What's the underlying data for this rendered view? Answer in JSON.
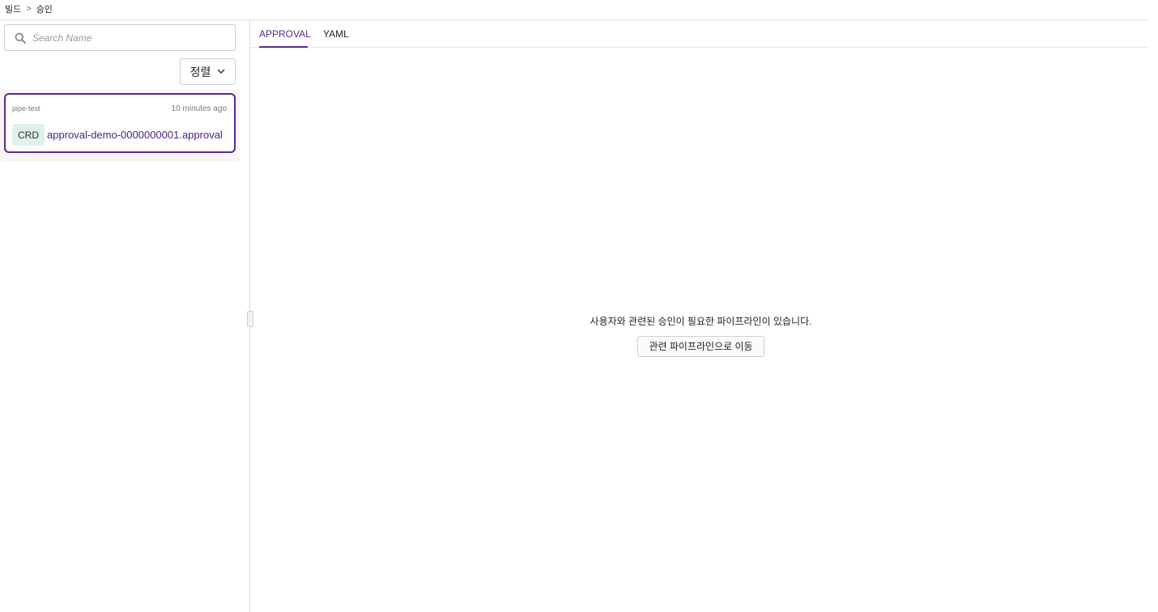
{
  "breadcrumb": {
    "items": [
      "빌드",
      "승인"
    ],
    "separator": ">"
  },
  "sidebar": {
    "search": {
      "placeholder": "Search Name",
      "value": "",
      "icon": "search-icon"
    },
    "sort": {
      "label": "정렬",
      "icon": "chevron-down-icon"
    },
    "items": [
      {
        "namespace": "pipe-test",
        "time": "10 minutes ago",
        "badge": "CRD",
        "title": "approval-demo-0000000001.approval",
        "selected": true
      }
    ]
  },
  "main": {
    "tabs": [
      {
        "label": "APPROVAL",
        "active": true
      },
      {
        "label": "YAML",
        "active": false
      }
    ],
    "empty_state": {
      "message": "사용자와 관련된 승인이 필요한 파이프라인이 있습니다.",
      "button_label": "관련 파이프라인으로 이동"
    }
  },
  "colors": {
    "accent": "#5b2a8c",
    "badge_bg": "#dff1ec",
    "border": "#cfcfcf"
  }
}
